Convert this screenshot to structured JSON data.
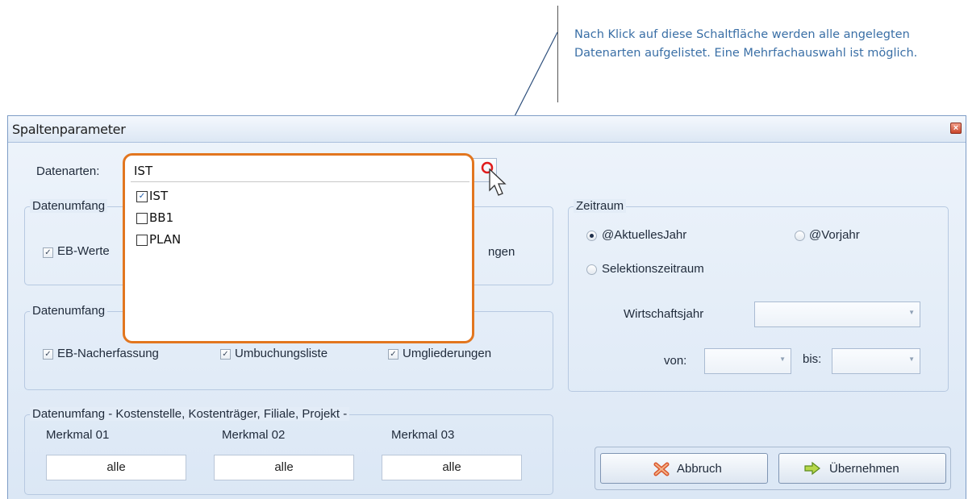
{
  "callout": {
    "text": "Nach Klick auf diese Schaltfläche werden alle angelegten Datenarten aufgelistet. Eine Mehrfachauswahl ist möglich."
  },
  "window": {
    "title": "Spaltenparameter",
    "close_icon": "close-icon"
  },
  "datenarten": {
    "label": "Datenarten:",
    "value": "IST",
    "options": [
      {
        "label": "IST",
        "checked": true
      },
      {
        "label": "BB1",
        "checked": false
      },
      {
        "label": "PLAN",
        "checked": false
      }
    ]
  },
  "group1": {
    "title": "Datenumfang",
    "items": [
      {
        "label": "EB-Werte",
        "checked": true
      },
      {
        "label": "ngen",
        "checked": true
      }
    ]
  },
  "group2": {
    "title": "Datenumfang",
    "items": [
      {
        "label": "EB-Nacherfassung",
        "checked": true
      },
      {
        "label": "Umbuchungsliste",
        "checked": true
      },
      {
        "label": "Umgliederungen",
        "checked": true
      }
    ]
  },
  "group3": {
    "title": "Datenumfang  - Kostenstelle, Kostenträger, Filiale, Projekt -",
    "fields": [
      {
        "label": "Merkmal 01",
        "value": "alle"
      },
      {
        "label": "Merkmal 02",
        "value": "alle"
      },
      {
        "label": "Merkmal 03",
        "value": "alle"
      }
    ]
  },
  "zeitraum": {
    "title": "Zeitraum",
    "radio_aktuelles": "@AktuellesJahr",
    "radio_vorjahr": "@Vorjahr",
    "radio_selektion": "Selektionszeitraum",
    "selected": "@AktuellesJahr",
    "wirtschaftsjahr_label": "Wirtschaftsjahr",
    "von_label": "von:",
    "bis_label": "bis:"
  },
  "buttons": {
    "cancel": "Abbruch",
    "apply": "Übernehmen"
  },
  "colors": {
    "highlight_border": "#e2761f",
    "callout_text": "#3a6fa6"
  }
}
